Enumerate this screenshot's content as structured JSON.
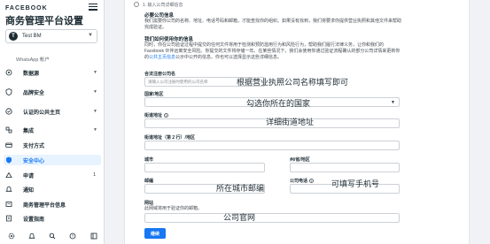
{
  "sidebar": {
    "brand": "FACEBOOK",
    "title": "商务管理平台设置",
    "business": {
      "avatar": "T",
      "name": "Test BM"
    },
    "subheading": "WhatsApp 帐户",
    "items": [
      {
        "label": "数据源",
        "icon": "data-sources-icon",
        "chevron": "▼"
      },
      {
        "label": "品牌安全",
        "icon": "shield-icon",
        "chevron": "▼"
      },
      {
        "label": "认证的公共主页",
        "icon": "verified-page-icon",
        "chevron": "▼"
      },
      {
        "label": "集成",
        "icon": "integrations-icon",
        "chevron": "▼"
      },
      {
        "label": "支付方式",
        "icon": "payment-icon"
      },
      {
        "label": "安全中心",
        "icon": "security-center-icon"
      },
      {
        "label": "申请",
        "icon": "requests-icon",
        "badge": "1"
      },
      {
        "label": "通知",
        "icon": "bell-icon"
      },
      {
        "label": "商务管理平台信息",
        "icon": "info-icon"
      },
      {
        "label": "设置指南",
        "icon": "guide-icon"
      }
    ],
    "footer_icons": [
      "gear-icon",
      "bell-icon",
      "search-icon",
      "help-icon",
      "layout-icon"
    ]
  },
  "form": {
    "step": "1. 输入公司详细信息",
    "required_heading": "必要公司信息",
    "required_text": "我们需要你公司的名称、地址、电话号码和邮箱，才能查找你的组织。如果没有找到，我们将要求你提供营业执照和其他文件来帮助完成验证。",
    "usage_heading": "我们如何使用你的信息",
    "usage_text_1": "同时，你在公司验证过程中提交的任何文件将用于检测和预防滥用行为和风险行为，帮助我们履行法律义务，让你和我们的 Facebook 伙伴远离安全风险。你提交的文件将存储一年。在某些情况下，我们会使用你通过验证流程确认的部分公司详情来更新你的",
    "usage_link": "公共主页信息",
    "usage_text_2": "公示中公开的信息。你也可以选择显示这些详细信息。",
    "company_name_label": "合法注册公司名",
    "company_name_placeholder": "请输入公司注册时使用的公司名称",
    "company_name_overlay": "根据营业执照公司名称填写即可",
    "country_label": "国家/地区",
    "country_overlay": "勾选你所在的国家",
    "street_label": "街道地址",
    "street_overlay": "详细街道地址",
    "street2_label": "街道地址（第 2 行）/地区",
    "city_label": "城市",
    "state_label": "州/省/地区",
    "zip_label": "邮编",
    "zip_overlay": "所在城市邮编",
    "phone_label": "公司电话",
    "phone_overlay": "可填写手机号",
    "website_label": "网站",
    "website_hint": "此网域将用于验证你的邮箱。",
    "website_overlay": "公司官网",
    "next_button": "继续"
  },
  "colors": {
    "accent": "#1877f2",
    "active_bg": "#e7f3ff"
  }
}
